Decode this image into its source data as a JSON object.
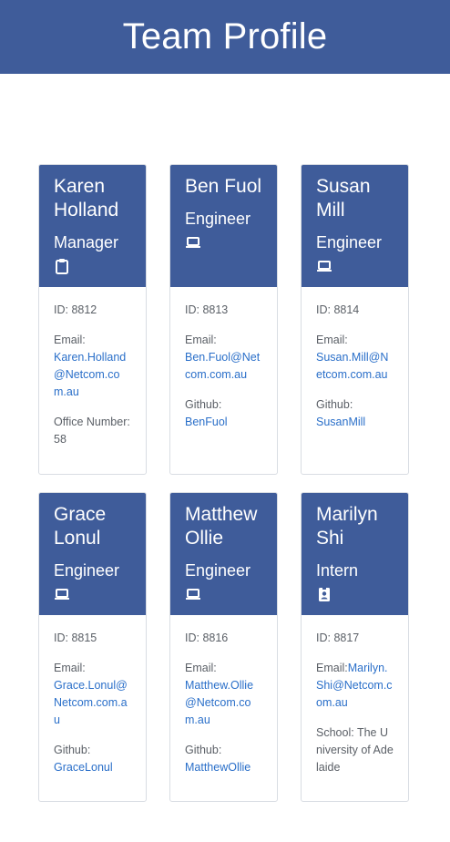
{
  "header": {
    "title": "Team Profile"
  },
  "cards": [
    {
      "name": "Karen Holland",
      "role": "Manager",
      "icon": "clipboard-icon",
      "id": "ID: 8812",
      "email_label": "Email:",
      "email": "Karen.Holland@Netcom.com.au",
      "extra_label": "Office Number:",
      "extra": "58"
    },
    {
      "name": "Ben Fuol",
      "role": "Engineer",
      "icon": "laptop-icon",
      "id": "ID: 8813",
      "email_label": "Email:",
      "email": "Ben.Fuol@Netcom.com.au",
      "extra_label": "Github:",
      "extra": "BenFuol"
    },
    {
      "name": "Susan Mill",
      "role": "Engineer",
      "icon": "laptop-icon",
      "id": "ID: 8814",
      "email_label": "Email:",
      "email": "Susan.Mill@Netcom.com.au",
      "extra_label": "Github:",
      "extra": "SusanMill"
    },
    {
      "name": "Grace Lonul",
      "role": "Engineer",
      "icon": "laptop-icon",
      "id": "ID: 8815",
      "email_label": "Email:",
      "email": "Grace.Lonul@Netcom.com.au",
      "extra_label": "Github:",
      "extra": "GraceLonul"
    },
    {
      "name": "Matthew Ollie",
      "role": "Engineer",
      "icon": "laptop-icon",
      "id": "ID: 8816",
      "email_label": "Email:",
      "email": "Matthew.Ollie@Netcom.com.au",
      "extra_label": "Github:",
      "extra": "MatthewOllie"
    },
    {
      "name": "Marilyn Shi",
      "role": "Intern",
      "icon": "id-badge-icon",
      "id": "ID: 8817",
      "email_label": "Email:",
      "email": "Marilyn.Shi@Netcom.com.au",
      "extra_label": "School:",
      "extra": "The University of Adelaide"
    }
  ]
}
